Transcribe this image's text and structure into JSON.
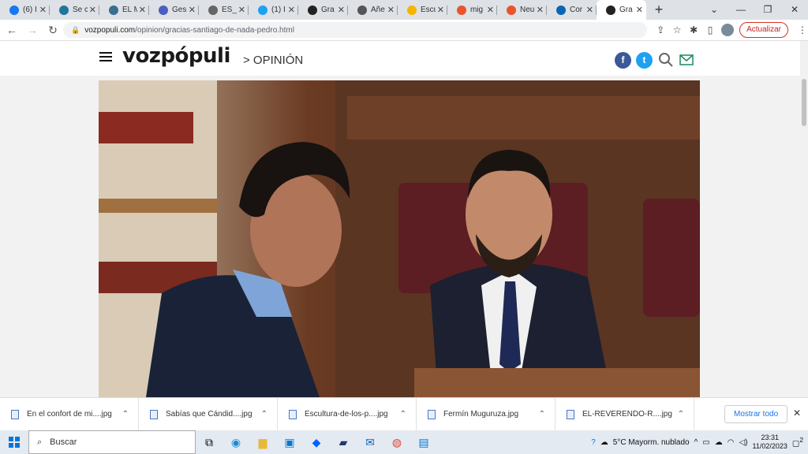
{
  "browser": {
    "tabs": [
      {
        "label": "(6) I",
        "icon": "facebook-icon",
        "color": "#1877f2"
      },
      {
        "label": "Se c",
        "icon": "wordpress-icon",
        "color": "#21759b"
      },
      {
        "label": "EL M",
        "icon": "globe-icon",
        "color": "#3c6e8f"
      },
      {
        "label": "Ges",
        "icon": "document-icon",
        "color": "#4a5fc1"
      },
      {
        "label": "ES_",
        "icon": "globe-icon",
        "color": "#666666"
      },
      {
        "label": "(1) I",
        "icon": "twitter-icon",
        "color": "#1da1f2"
      },
      {
        "label": "Gra",
        "icon": "vozpopuli-icon",
        "color": "#222222"
      },
      {
        "label": "Añe",
        "icon": "mail-icon",
        "color": "#555555"
      },
      {
        "label": "Escu",
        "icon": "circle-icon",
        "color": "#f4b400"
      },
      {
        "label": "mig",
        "icon": "circle-icon",
        "color": "#e8542f"
      },
      {
        "label": "Neu",
        "icon": "circle-icon",
        "color": "#e8542f"
      },
      {
        "label": "Cor",
        "icon": "outlook-icon",
        "color": "#0a64b4"
      },
      {
        "label": "Gra",
        "icon": "vozpopuli-icon",
        "color": "#222222",
        "active": true
      }
    ],
    "url_host": "vozpopuli.com",
    "url_path": "/opinion/gracias-santiago-de-nada-pedro.html",
    "update_label": "Actualizar"
  },
  "site": {
    "logo": "vozpópuli",
    "section": "> OPINIÓN",
    "social": [
      {
        "name": "facebook",
        "glyph": "f",
        "color": "#3b5998"
      },
      {
        "name": "twitter",
        "glyph": "t",
        "color": "#1da1f2"
      }
    ]
  },
  "downloads": {
    "items": [
      "En el confort de mi....jpg",
      "Sabías que Cándid....jpg",
      "Escultura-de-los-p....jpg",
      "Fermín Muguruza.jpg",
      "EL-REVERENDO-R....jpg"
    ],
    "show_all": "Mostrar todo"
  },
  "taskbar": {
    "search_placeholder": "Buscar",
    "weather": "5°C  Mayorm. nublado",
    "time": "23:31",
    "date": "11/02/2023",
    "notif_count": "2"
  }
}
